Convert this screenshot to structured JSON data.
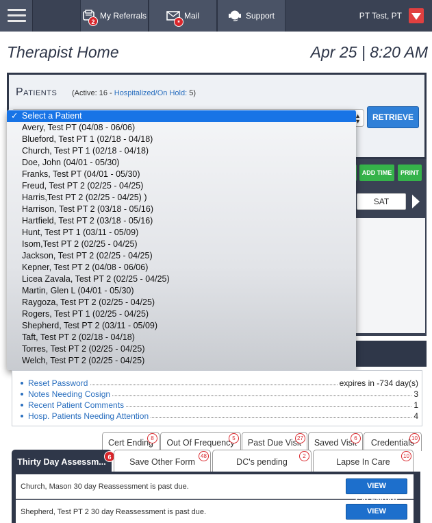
{
  "nav": {
    "referrals": {
      "label": "My Referrals",
      "badge": "2"
    },
    "mail": {
      "label": "Mail",
      "badge": "*"
    },
    "support": {
      "label": "Support"
    },
    "user": "PT Test, PT"
  },
  "page": {
    "title": "Therapist Home",
    "date": "Apr 25 | 8:20 AM"
  },
  "patients": {
    "title": "Patients",
    "active_text": "(Active: 16  - ",
    "hospitalized_text": "Hospitalized/On Hold:",
    "hospitalized_count": " 5)",
    "retrieve_label": "RETRIEVE",
    "dropdown": [
      "Select a Patient",
      "Avery, Test PT (04/08 - 06/06)",
      "Blueford, Test PT 1 (02/18 - 04/18)",
      "Church, Test PT 1 (02/18 - 04/18)",
      "Doe, John (04/01 - 05/30)",
      "Franks, Test PT (04/01 - 05/30)",
      "Freud, Test PT 2 (02/25 - 04/25)",
      "Harris,Test PT 2 (02/25 - 04/25) )",
      "Harrison, Test PT 2 (03/18 - 05/16)",
      "Hartfield, Test PT 2 (03/18 - 05/16)",
      "Hunt, Test PT 1 (03/11 - 05/09)",
      "Isom,Test PT 2 (02/25 - 04/25)",
      "Jackson, Test PT 2 (02/25 - 04/25)",
      "Kepner, Test PT 2 (04/08 - 06/06)",
      "Licea Zavala, Test PT 2 (02/25 - 04/25)",
      "Martin, Glen L (04/01 - 05/30)",
      "Raygoza, Test PT 2 (02/25 - 04/25)",
      "Rogers, Test PT 1 (02/25 - 04/25)",
      "Shepherd, Test PT 2 (03/11 - 05/09)",
      "Taft, Test PT 2 (02/18 - 04/18)",
      "Torres, Test PT 2 (02/25 - 04/25)",
      "Welch,  Test PT 2 (02/25 - 04/25)"
    ]
  },
  "schedule": {
    "add_time": "ADD TIME",
    "print": "PRINT",
    "day": "SAT"
  },
  "info": [
    {
      "label": "Reset Password",
      "value": "expires in -734 day(s)"
    },
    {
      "label": "Notes Needing Cosign",
      "value": "3"
    },
    {
      "label": "Recent Patient Comments",
      "value": "1"
    },
    {
      "label": "Hosp. Patients Needing Attention",
      "value": "4"
    }
  ],
  "small_tabs": [
    {
      "label": "Cert Ending",
      "count": "8"
    },
    {
      "label": "Out Of Frequency",
      "count": "5"
    },
    {
      "label": "Past Due Visit",
      "count": "27"
    },
    {
      "label": "Saved Visit",
      "count": "6"
    },
    {
      "label": "Credentials",
      "count": "10"
    }
  ],
  "large_tabs": [
    {
      "label": "Thirty Day Assessm...",
      "count": "6"
    },
    {
      "label": "Save Other Form",
      "count": "48"
    },
    {
      "label": "DC's pending",
      "count": "2"
    },
    {
      "label": "Lapse In Care",
      "count": "10"
    }
  ],
  "list": [
    {
      "text": "Church, Mason 30 day Reassessment is past due.",
      "button": "VIEW CALENDAR"
    },
    {
      "text": "Shepherd, Test PT 2 30 day Reassessment is past due.",
      "button": "VIEW CALENDAR"
    }
  ],
  "colors": {
    "nav_bg": "#3a4254",
    "accent_blue": "#2f80d8",
    "badge_red": "#d9262b",
    "green": "#35b34a"
  }
}
